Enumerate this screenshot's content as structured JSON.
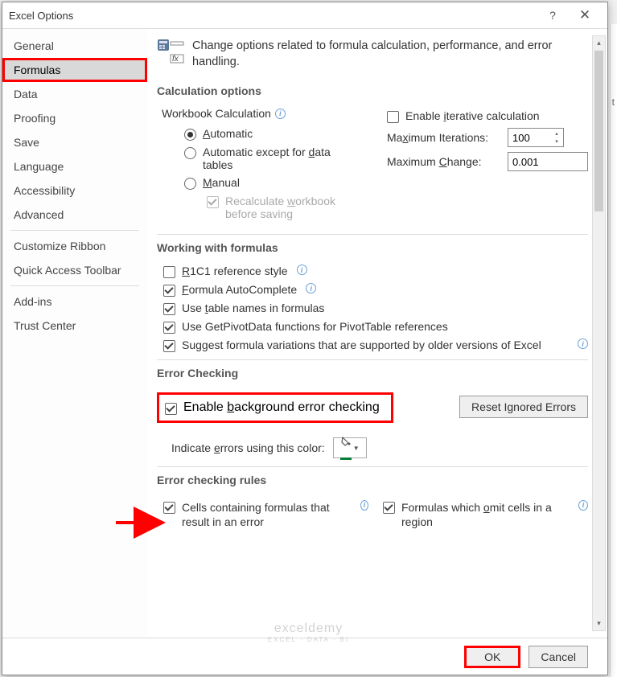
{
  "title": "Excel Options",
  "sidebar": {
    "groups": [
      [
        "General",
        "Formulas",
        "Data",
        "Proofing",
        "Save",
        "Language",
        "Accessibility",
        "Advanced"
      ],
      [
        "Customize Ribbon",
        "Quick Access Toolbar"
      ],
      [
        "Add-ins",
        "Trust Center"
      ]
    ],
    "selected": "Formulas"
  },
  "intro": "Change options related to formula calculation, performance, and error handling.",
  "sections": {
    "calc": {
      "header": "Calculation options",
      "workbook_label": "Workbook Calculation",
      "radios": {
        "auto": "Automatic",
        "auto_except": "Automatic except for data tables",
        "manual": "Manual"
      },
      "recalc": "Recalculate workbook before saving",
      "iter_enable": "Enable iterative calculation",
      "max_iter_label": "Maximum Iterations:",
      "max_iter_val": "100",
      "max_change_label": "Maximum Change:",
      "max_change_val": "0.001"
    },
    "working": {
      "header": "Working with formulas",
      "items": [
        "R1C1 reference style",
        "Formula AutoComplete",
        "Use table names in formulas",
        "Use GetPivotData functions for PivotTable references",
        "Suggest formula variations that are supported by older versions of Excel"
      ]
    },
    "errcheck": {
      "header": "Error Checking",
      "enable": "Enable background error checking",
      "indicate": "Indicate errors using this color:",
      "reset": "Reset Ignored Errors"
    },
    "rules": {
      "header": "Error checking rules",
      "left": "Cells containing formulas that result in an error",
      "right": "Formulas which omit cells in a region"
    }
  },
  "buttons": {
    "ok": "OK",
    "cancel": "Cancel"
  },
  "watermark": {
    "main": "exceldemy",
    "sub": "EXCEL · DATA · BI"
  },
  "stray": "t"
}
